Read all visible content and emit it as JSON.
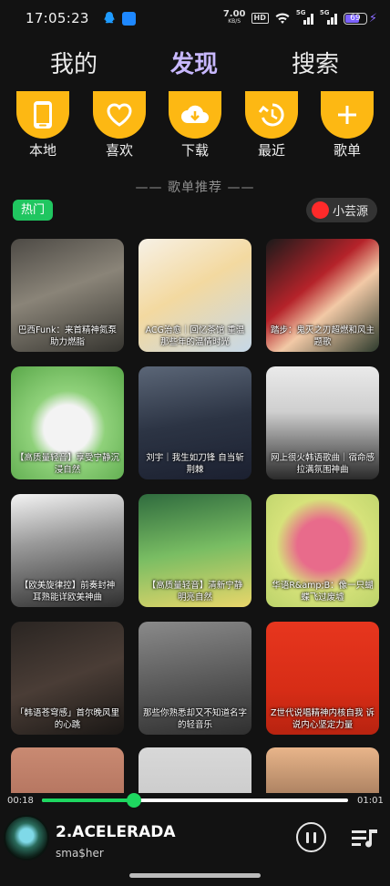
{
  "status_bar": {
    "time": "17:05:23",
    "net_speed": "7.00",
    "net_unit": "KB/S",
    "hd": "HD",
    "sig1": "5G",
    "sig2": "5G",
    "battery": "69"
  },
  "tabs": [
    {
      "label": "我的",
      "active": false
    },
    {
      "label": "发现",
      "active": true
    },
    {
      "label": "搜索",
      "active": false
    }
  ],
  "shortcuts": [
    {
      "label": "本地",
      "icon": "phone-icon"
    },
    {
      "label": "喜欢",
      "icon": "heart-icon"
    },
    {
      "label": "下载",
      "icon": "cloud-download-icon"
    },
    {
      "label": "最近",
      "icon": "history-icon"
    },
    {
      "label": "歌单",
      "icon": "plus-icon"
    }
  ],
  "section_title": "—— 歌单推荐 ——",
  "filter": {
    "hot_label": "热门",
    "source_label": "小芸源"
  },
  "playlists": [
    {
      "caption": "巴西Funk：来首精神氮泵助力燃脂",
      "bg": "linear-gradient(160deg,#4d4a45 0%,#8a8478 45%,#35342f 100%)"
    },
    {
      "caption": "ACG治愈｜回忆茶馆 重温那些年的温情时光",
      "bg": "linear-gradient(150deg,#f7f1e6 0%,#f3d9a0 45%,#c6d8e8 100%)"
    },
    {
      "caption": "踏步：鬼灭之刃超燃和风主题歌",
      "bg": "linear-gradient(140deg,#1a1a1a 0%,#b5232a 40%,#f2c9a6 60%,#2c3a2c 100%)"
    },
    {
      "caption": "【高质量轻音】享受宁静沉浸自然",
      "bg": "radial-gradient(circle at 50% 55%,#f3f3f3 0 28%,#8fd17a 45%,#5aa84a 100%)"
    },
    {
      "caption": "刘宇｜我生如刀锋 自当斩荆棘",
      "bg": "linear-gradient(170deg,#5b6677 0%,#2c3444 50%,#1b2030 100%)"
    },
    {
      "caption": "网上很火韩语歌曲｜宿命感拉满氛围神曲",
      "bg": "linear-gradient(180deg,#eaeaea 0%,#cfcfcf 40%,#2a2a2a 100%)"
    },
    {
      "caption": "【欧美旋律控】前奏封神 耳熟能详欧美神曲",
      "bg": "linear-gradient(170deg,#f4f4f4 0%,#9a9a9a 40%,#2e2e2e 100%)"
    },
    {
      "caption": "【高质量轻音】清新宁静 明亮自然",
      "bg": "linear-gradient(170deg,#2f6b3e 0%,#79bd63 50%,#e9d66a 100%)"
    },
    {
      "caption": "华语R&amp;B：像一只蝴蝶飞过废墟",
      "bg": "radial-gradient(circle at 50% 45%,#e86b8b 0 30%,#d6e27a 55%,#bcd36b 100%)"
    },
    {
      "caption": "「韩语苍穹感」首尔晚风里的心跳",
      "bg": "linear-gradient(160deg,#2a2522 0%,#4a3d36 50%,#1a1715 100%)"
    },
    {
      "caption": "那些你熟悉却又不知道名字的轻音乐",
      "bg": "linear-gradient(170deg,#8a8a8a 0%,#5c5c5c 50%,#2f2f2f 100%)"
    },
    {
      "caption": "Z世代说唱精神内核自我 诉说内心坚定力量",
      "bg": "linear-gradient(180deg,#e7361e 0%,#d72d16 60%,#b82310 100%)"
    },
    {
      "caption": "",
      "bg": "linear-gradient(180deg,#c98a72 0%,#9c5b4a 100%)"
    },
    {
      "caption": "",
      "bg": "linear-gradient(180deg,#d8d8d8 0%,#bdbdbd 100%)"
    },
    {
      "caption": "",
      "bg": "linear-gradient(180deg,#e8b58a 0%,#5a3a2a 100%)"
    }
  ],
  "player": {
    "current_time": "00:18",
    "total_time": "01:01",
    "progress": 0.3,
    "song_title": "2.ACELERADA",
    "artist": "sma$her"
  },
  "colors": {
    "accent": "#1ed760",
    "shortcut_bg": "#fdb813",
    "active_tab": "#c8b8ff"
  }
}
